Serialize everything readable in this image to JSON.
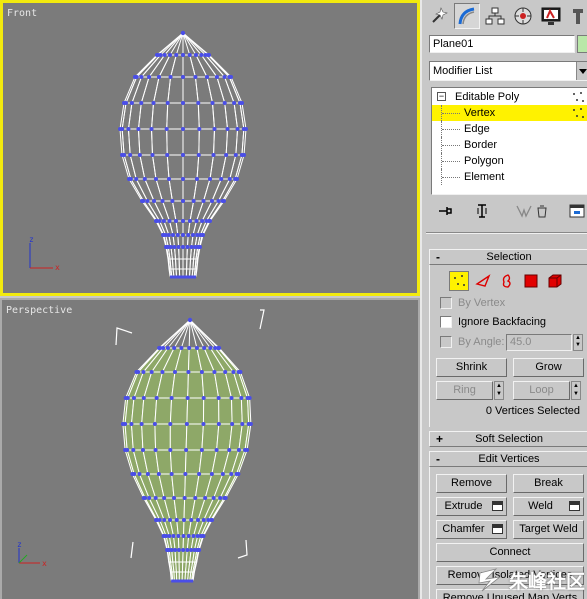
{
  "viewports": {
    "front": {
      "label": "Front",
      "axis_x": "x",
      "axis_y": "z"
    },
    "perspective": {
      "label": "Perspective",
      "axis_x": "x",
      "axis_y": "z"
    }
  },
  "panel": {
    "tabs": [
      "create-icon",
      "modify-icon",
      "hierarchy-icon",
      "motion-icon",
      "display-icon",
      "utilities-icon"
    ],
    "object_name": "Plane01",
    "object_color": "#b9e8a8",
    "modifier_list_label": "Modifier List",
    "stack": {
      "root": "Editable Poly",
      "items": [
        "Vertex",
        "Edge",
        "Border",
        "Polygon",
        "Element"
      ],
      "selected": "Vertex"
    },
    "selection": {
      "title": "Selection",
      "by_vertex": "By Vertex",
      "ignore_backfacing": "Ignore Backfacing",
      "by_angle": "By Angle:",
      "angle_value": "45.0",
      "shrink": "Shrink",
      "grow": "Grow",
      "ring": "Ring",
      "loop": "Loop",
      "status": "0 Vertices Selected"
    },
    "soft_selection": {
      "title": "Soft Selection"
    },
    "edit_vertices": {
      "title": "Edit Vertices",
      "remove": "Remove",
      "break": "Break",
      "extrude": "Extrude",
      "weld": "Weld",
      "chamfer": "Chamfer",
      "target_weld": "Target Weld",
      "connect": "Connect",
      "remove_isolated": "Remove Isolated Vertices",
      "remove_unused": "Remove Unused Map Verts"
    },
    "accent_color": "#fff200",
    "viewport_active_border": "#f2ea0e"
  },
  "watermark": {
    "text": "朱峰社区"
  }
}
